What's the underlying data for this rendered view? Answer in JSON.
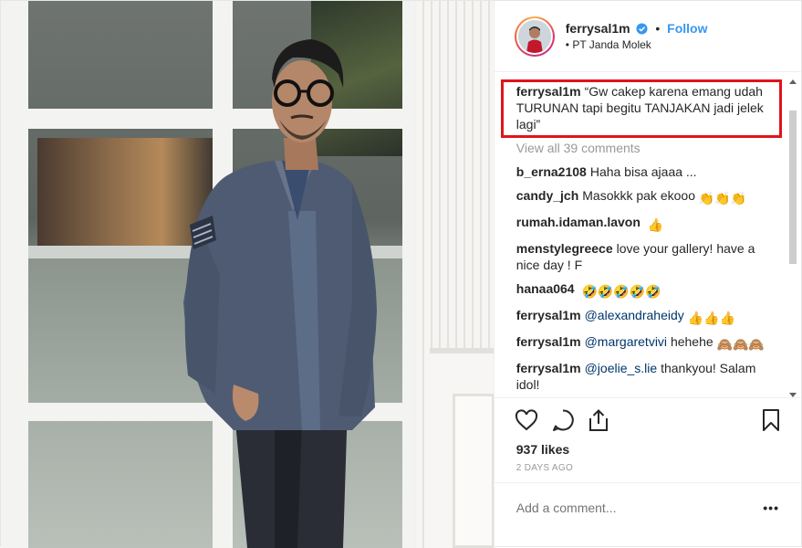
{
  "post": {
    "username": "ferrysal1m",
    "separator": "•",
    "follow_label": "Follow",
    "location": "PT Janda Molek",
    "caption": {
      "user": "ferrysal1m",
      "text": "“Gw cakep karena emang udah TURUNAN tapi begitu TANJAKAN jadi jelek lagi”"
    },
    "view_all_label": "View all 39 comments",
    "comments": [
      {
        "user": "b_erna2108",
        "text": "Haha bisa ajaaa ...",
        "emoji": ""
      },
      {
        "user": "candy_jch",
        "text": "Masokkk pak ekooo",
        "emoji": "👏👏👏"
      },
      {
        "user": "rumah.idaman.lavon",
        "text": "",
        "emoji": "👍"
      },
      {
        "user": "menstylegreece",
        "text": "love your gallery! have a nice day ! F",
        "emoji": ""
      },
      {
        "user": "hanaa064",
        "text": "",
        "emoji": "🤣🤣🤣🤣🤣"
      },
      {
        "user": "ferrysal1m",
        "mention": "@alexandraheidy",
        "text": "",
        "emoji": "👍👍👍"
      },
      {
        "user": "ferrysal1m",
        "mention": "@margaretvivi",
        "text": "hehehe",
        "emoji": "🙈🙈🙈"
      },
      {
        "user": "ferrysal1m",
        "mention": "@joelie_s.lie",
        "text": "thankyou! Salam idol!",
        "emoji": ""
      }
    ],
    "likes": "937 likes",
    "time": "2 DAYS AGO",
    "add_comment_placeholder": "Add a comment...",
    "more_label": "•••",
    "icons": [
      "heart-icon",
      "comment-icon",
      "share-icon",
      "bookmark-icon",
      "verified-badge-icon"
    ],
    "colors": {
      "follow": "#3897f0",
      "highlight_box": "#e0141c",
      "mention": "#003569",
      "muted": "#999999"
    }
  }
}
